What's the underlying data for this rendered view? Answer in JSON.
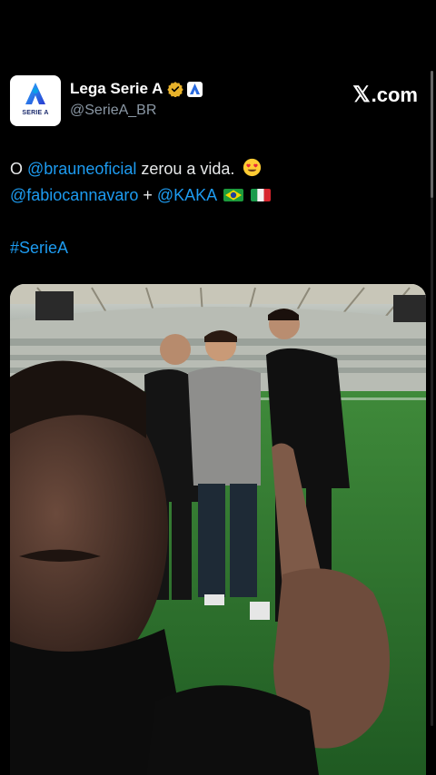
{
  "account": {
    "display_name": "Lega Serie A",
    "handle": "@SerieA_BR",
    "avatar_logo_text": "SERIE A",
    "verified_icon": "verified-badge-gold",
    "affiliate_icon": "serie-a-affiliate-badge"
  },
  "brand": {
    "x_symbol": "𝕏",
    "suffix": ".com"
  },
  "tweet": {
    "line1": {
      "prefix": "O ",
      "mention": "@brauneoficial",
      "suffix": " zerou a vida.",
      "emoji": "heart-eyes-emoji"
    },
    "line2": {
      "mention1": "@fabiocannavaro",
      "joiner": " + ",
      "mention2": "@KAKA",
      "flags": [
        "brazil-flag",
        "italy-flag"
      ]
    },
    "hashtag": "#SerieA"
  },
  "media": {
    "type": "photo",
    "description_icon": "stadium-photo"
  },
  "colors": {
    "background": "#000000",
    "link": "#1d9bf0",
    "text": "#e7e9ea",
    "muted": "#8b98a5",
    "verified": "#e8b22a"
  }
}
